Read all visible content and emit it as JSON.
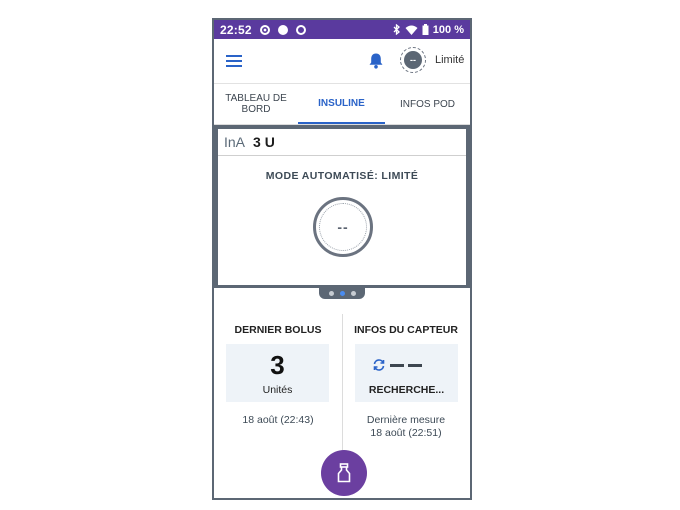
{
  "statusbar": {
    "time": "22:52",
    "battery": "100 %",
    "icons": [
      "record-icon",
      "circle-icon",
      "sync-icon",
      "bluetooth-icon",
      "wifi-icon",
      "battery-icon"
    ]
  },
  "appbar": {
    "status_avatar": "--",
    "status_label": "Limité",
    "icons": [
      "menu-icon",
      "bell-icon"
    ]
  },
  "tabs": [
    {
      "label": "TABLEAU DE BORD"
    },
    {
      "label": "INSULINE"
    },
    {
      "label": "INFOS POD"
    }
  ],
  "dashboard": {
    "ina_label": "InA",
    "ina_value": "3 U",
    "mode": "MODE AUTOMATISÉ: LIMITÉ",
    "gauge": "--"
  },
  "pager": {
    "count": 3,
    "active": 2
  },
  "bolus": {
    "title": "DERNIER BOLUS",
    "value": "3",
    "units": "Unités",
    "time": "18 août (22:43)"
  },
  "sensor": {
    "title": "INFOS DU CAPTEUR",
    "status": "RECHERCHE...",
    "meta_line1": "Dernière mesure",
    "meta_line2": "18 août (22:51)"
  },
  "colors": {
    "statusbar": "#5a3a9e",
    "accent": "#2a63c8",
    "fab": "#6b3fa0",
    "frame": "#5c6774"
  }
}
